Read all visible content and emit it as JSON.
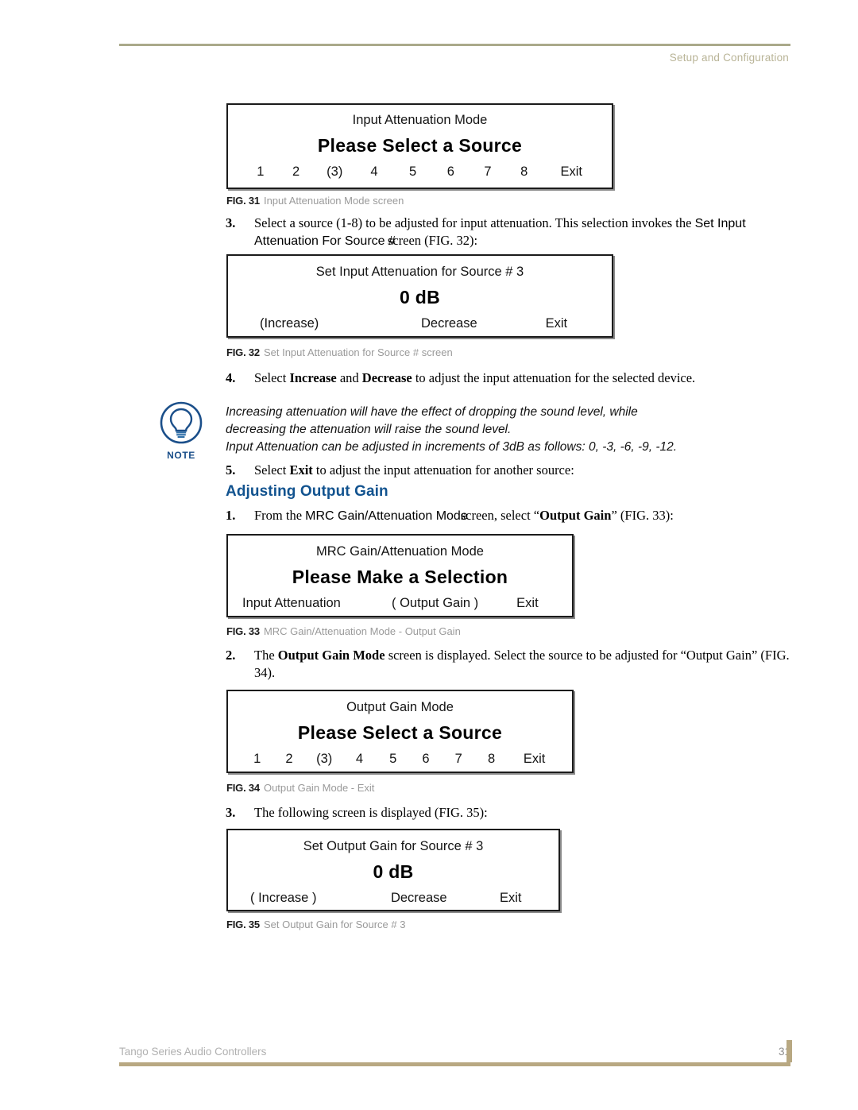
{
  "header": {
    "title": "Setup and Configuration"
  },
  "figures": {
    "fig31": {
      "title": "Input Attenuation Mode",
      "heading": "Please Select a Source",
      "options": [
        "1",
        "2",
        "(3)",
        "4",
        "5",
        "6",
        "7",
        "8",
        "Exit"
      ],
      "caption_label": "FIG. 31",
      "caption_text": "Input Attenuation Mode screen"
    },
    "fig32": {
      "title": "Set Input Attenuation for Source # 3",
      "value": "0 dB",
      "options": [
        "(Increase)",
        "Decrease",
        "Exit"
      ],
      "caption_label": "FIG. 32",
      "caption_text": "Set Input Attenuation for Source # screen"
    },
    "fig33": {
      "title": "MRC Gain/Attenuation Mode",
      "heading": "Please Make a Selection",
      "options": [
        "Input Attenuation",
        "( Output Gain )",
        "Exit"
      ],
      "caption_label": "FIG. 33",
      "caption_text": "MRC Gain/Attenuation Mode - Output Gain"
    },
    "fig34": {
      "title": "Output Gain Mode",
      "heading": "Please Select a Source",
      "options": [
        "1",
        "2",
        "(3)",
        "4",
        "5",
        "6",
        "7",
        "8",
        "Exit"
      ],
      "caption_label": "FIG. 34",
      "caption_text": "Output Gain Mode - Exit"
    },
    "fig35": {
      "title": "Set Output Gain for Source # 3",
      "value": "0 dB",
      "options": [
        "( Increase )",
        "Decrease",
        "Exit"
      ],
      "caption_label": "FIG. 35",
      "caption_text": "Set Output Gain for Source # 3"
    }
  },
  "steps": {
    "step3_attenuation": {
      "num": "3.",
      "text_a": "Select a source (1-8) to be adjusted for input attenuation. This selection invokes the ",
      "sans_a": "Set Input Attenuation For Source #",
      "text_b": "screen (FIG. 32):"
    },
    "step4_attenuation": {
      "num": "4.",
      "text_a": "Select ",
      "bold_a": "Increase",
      "text_b": " and ",
      "bold_b": "Decrease",
      "text_c": " to adjust the input attenuation for the selected device."
    },
    "step5_attenuation": {
      "num": "5.",
      "text_a": "Select ",
      "bold_a": "Exit",
      "text_b": " to adjust the input attenuation for another source:"
    },
    "gain_step1": {
      "num": "1.",
      "text_a": "From the ",
      "sans_a": "MRC Gain/Attenuation Mode",
      "text_b": "screen, select “",
      "bold_b": "Output Gain",
      "text_c": "” (FIG. 33):"
    },
    "gain_step2": {
      "num": "2.",
      "text_a": "The ",
      "bold_a": "Output Gain Mode",
      "text_b": " screen is displayed. Select the source to be adjusted for “Output Gain” (FIG. 34)."
    },
    "gain_step3": {
      "num": "3.",
      "text_a": "The following screen is displayed (FIG. 35):"
    }
  },
  "note": {
    "icon_label": "NOTE",
    "line1": "Increasing attenuation will have the effect of dropping the sound level, while",
    "line2": "decreasing the attenuation will raise the sound level.",
    "line3": "Input Attenuation can be adjusted in increments of 3dB as follows: 0, -3, -6, -9, -12."
  },
  "section": {
    "adjusting_output_gain": "Adjusting Output Gain"
  },
  "footer": {
    "doc_title": "Tango Series Audio Controllers",
    "page_number": "31"
  },
  "colors": {
    "header_rule": "#aaa98a",
    "header_text": "#b9b497",
    "footer_rule": "#b8a882",
    "heading_blue": "#12538f",
    "note_blue": "#1b4f8a"
  }
}
